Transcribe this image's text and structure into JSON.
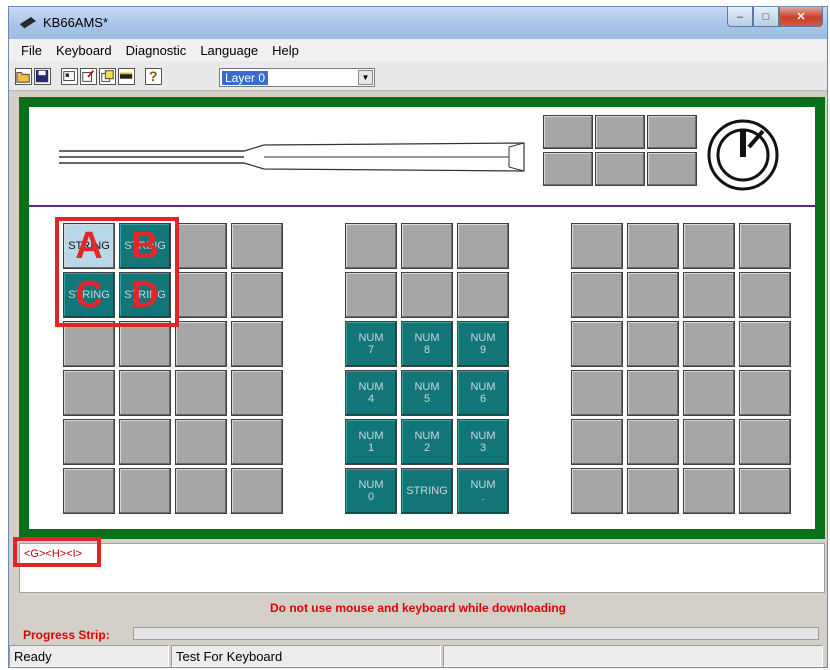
{
  "window": {
    "title": "KB66AMS*",
    "minimize_glyph": "–",
    "maximize_glyph": "□",
    "close_glyph": "✕"
  },
  "menu": {
    "items": [
      "File",
      "Keyboard",
      "Diagnostic",
      "Language",
      "Help"
    ]
  },
  "toolbar": {
    "icons": [
      "open-icon",
      "save-icon",
      "layout-icon",
      "edit-icon",
      "copy-icon",
      "fill-icon",
      "help-icon"
    ],
    "help_glyph": "?",
    "layer_select": {
      "value": "Layer 0",
      "arrow": "▼"
    }
  },
  "keyboard": {
    "left_block": {
      "rows": [
        [
          {
            "label": "STRING",
            "overlay": "A",
            "style": "blue"
          },
          {
            "label": "STRING",
            "overlay": "B",
            "style": "teal"
          },
          {
            "label": "",
            "style": "gray"
          },
          {
            "label": "",
            "style": "gray"
          }
        ],
        [
          {
            "label": "STRING",
            "overlay": "C",
            "style": "teal"
          },
          {
            "label": "STRING",
            "overlay": "D",
            "style": "teal"
          },
          {
            "label": "",
            "style": "gray"
          },
          {
            "label": "",
            "style": "gray"
          }
        ],
        [
          {
            "label": "",
            "style": "gray"
          },
          {
            "label": "",
            "style": "gray"
          },
          {
            "label": "",
            "style": "gray"
          },
          {
            "label": "",
            "style": "gray"
          }
        ],
        [
          {
            "label": "",
            "style": "gray"
          },
          {
            "label": "",
            "style": "gray"
          },
          {
            "label": "",
            "style": "gray"
          },
          {
            "label": "",
            "style": "gray"
          }
        ],
        [
          {
            "label": "",
            "style": "gray"
          },
          {
            "label": "",
            "style": "gray"
          },
          {
            "label": "",
            "style": "gray"
          },
          {
            "label": "",
            "style": "gray"
          }
        ],
        [
          {
            "label": "",
            "style": "gray"
          },
          {
            "label": "",
            "style": "gray"
          },
          {
            "label": "",
            "style": "gray"
          },
          {
            "label": "",
            "style": "gray"
          }
        ]
      ]
    },
    "middle_block": {
      "rows": [
        [
          {
            "label": "",
            "style": "gray"
          },
          {
            "label": "",
            "style": "gray"
          },
          {
            "label": "",
            "style": "gray"
          }
        ],
        [
          {
            "label": "",
            "style": "gray"
          },
          {
            "label": "",
            "style": "gray"
          },
          {
            "label": "",
            "style": "gray"
          }
        ],
        [
          {
            "label": "NUM\n7",
            "style": "teal"
          },
          {
            "label": "NUM\n8",
            "style": "teal"
          },
          {
            "label": "NUM\n9",
            "style": "teal"
          }
        ],
        [
          {
            "label": "NUM\n4",
            "style": "teal"
          },
          {
            "label": "NUM\n5",
            "style": "teal"
          },
          {
            "label": "NUM\n6",
            "style": "teal"
          }
        ],
        [
          {
            "label": "NUM\n1",
            "style": "teal"
          },
          {
            "label": "NUM\n2",
            "style": "teal"
          },
          {
            "label": "NUM\n3",
            "style": "teal"
          }
        ],
        [
          {
            "label": "NUM\n0",
            "style": "teal"
          },
          {
            "label": "STRING",
            "style": "teal"
          },
          {
            "label": "NUM\n.",
            "style": "teal"
          }
        ]
      ]
    },
    "right_block": {
      "rows": 6,
      "cols": 4
    },
    "top_keys": {
      "rows": 2,
      "cols": 3
    }
  },
  "output": {
    "text": "<G><H><I>"
  },
  "warning": "Do not use mouse and keyboard while downloading",
  "progress": {
    "label": "Progress Strip:",
    "value": 0
  },
  "status": {
    "panes": [
      "Ready",
      "Test For Keyboard",
      ""
    ]
  },
  "colors": {
    "frame_green": "#0b6e19",
    "key_teal": "#127678",
    "key_gray": "#a6a6a6",
    "highlight_red": "#e02526",
    "warning_red": "#e00000"
  }
}
